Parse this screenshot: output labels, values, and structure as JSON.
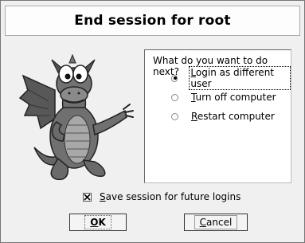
{
  "dialog": {
    "title": "End session for root"
  },
  "options": {
    "question": "What do you want to do next?",
    "items": [
      {
        "pre": "",
        "accel": "L",
        "rest": "ogin as different user",
        "selected": true
      },
      {
        "pre": "",
        "accel": "T",
        "rest": "urn off computer",
        "selected": false
      },
      {
        "pre": "",
        "accel": "R",
        "rest": "estart computer",
        "selected": false
      }
    ]
  },
  "save_session": {
    "pre": "",
    "accel": "S",
    "rest": "ave session for future logins",
    "checked": true
  },
  "buttons": {
    "ok": {
      "pre": "",
      "accel": "O",
      "rest": "K"
    },
    "cancel": {
      "pre": "",
      "accel": "C",
      "rest": "ancel"
    }
  },
  "mascot": {
    "icon": "dragon-mascot-icon",
    "colors": {
      "body": "#6e6e6e",
      "belly": "#a8a8a8",
      "outline": "#2a2a2a"
    }
  }
}
